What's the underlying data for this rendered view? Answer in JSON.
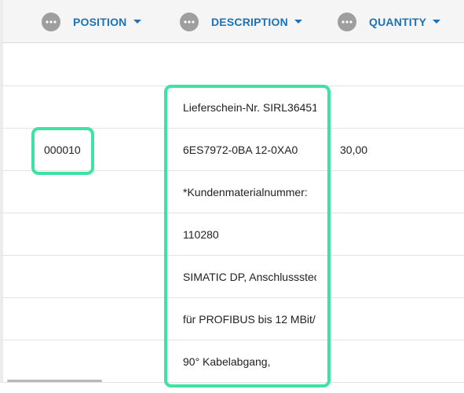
{
  "header": {
    "columns": [
      {
        "label": "POSITION",
        "icon": "more-icon"
      },
      {
        "label": "DESCRIPTION",
        "icon": "more-icon"
      },
      {
        "label": "QUANTITY",
        "icon": "more-icon"
      }
    ]
  },
  "rows": [
    {
      "position": "",
      "description": "",
      "quantity": ""
    },
    {
      "position": "",
      "description": "Lieferschein-Nr. SIRL36451",
      "quantity": ""
    },
    {
      "position": "000010",
      "description": "6ES7972-0BA 12-0XA0",
      "quantity": "30,00"
    },
    {
      "position": "",
      "description": "*Kundenmaterialnummer:",
      "quantity": ""
    },
    {
      "position": "",
      "description": "110280",
      "quantity": ""
    },
    {
      "position": "",
      "description": "SIMATIC DP, Anschlussstec",
      "quantity": ""
    },
    {
      "position": "",
      "description": "für PROFIBUS bis 12 MBit/",
      "quantity": ""
    },
    {
      "position": "",
      "description": "90° Kabelabgang,",
      "quantity": ""
    }
  ],
  "colors": {
    "header_text": "#1a73b8",
    "highlight": "#3de3a3",
    "dots": "#9e9e9e"
  }
}
